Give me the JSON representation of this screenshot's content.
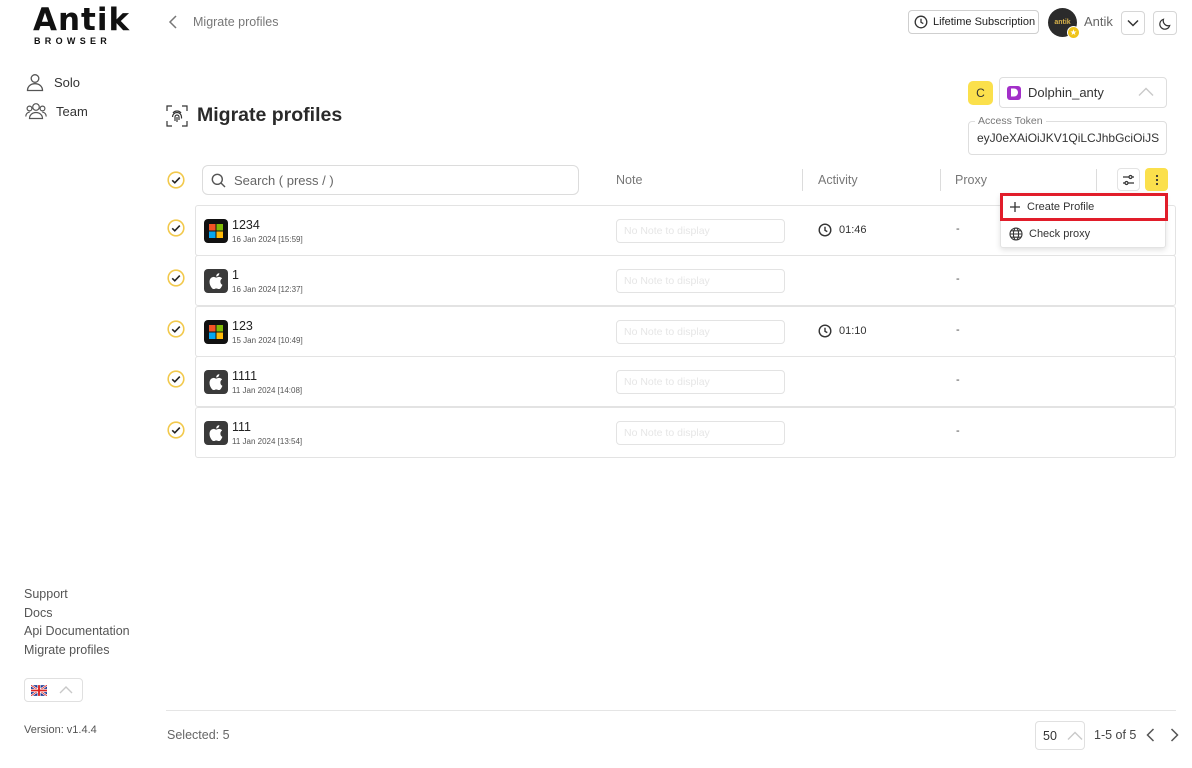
{
  "brand": {
    "logo_text": "Antik",
    "logo_sub": "BROWSER"
  },
  "sidebar": {
    "nav": [
      {
        "label": "Solo",
        "icon": "user-icon"
      },
      {
        "label": "Team",
        "icon": "team-icon"
      }
    ],
    "footer_links": [
      "Support",
      "Docs",
      "Api Documentation",
      "Migrate profiles"
    ],
    "language": "en-GB",
    "version": "Version: v1.4.4"
  },
  "topbar": {
    "breadcrumb": "Migrate profiles",
    "subscription_label": "Lifetime Subscription",
    "avatar_text": "antik",
    "username": "Antik"
  },
  "page": {
    "title": "Migrate profiles",
    "source_badge": "C",
    "source_select": "Dolphin_anty",
    "token_label": "Access Token",
    "token_value": "eyJ0eXAiOiJKV1QiLCJhbGciOiJS"
  },
  "table": {
    "search_placeholder": "Search ( press / )",
    "columns": {
      "note": "Note",
      "activity": "Activity",
      "proxy": "Proxy"
    },
    "note_placeholder": "No Note to display",
    "rows": [
      {
        "name": "1234",
        "date": "16 Jan 2024 [15:59]",
        "os": "windows",
        "activity": "01:46",
        "proxy": "-"
      },
      {
        "name": "1",
        "date": "16 Jan 2024 [12:37]",
        "os": "macos",
        "activity": "",
        "proxy": "-"
      },
      {
        "name": "123",
        "date": "15 Jan 2024 [10:49]",
        "os": "windows",
        "activity": "01:10",
        "proxy": "-"
      },
      {
        "name": "1111",
        "date": "11 Jan 2024 [14:08]",
        "os": "macos",
        "activity": "",
        "proxy": "-"
      },
      {
        "name": "111",
        "date": "11 Jan 2024 [13:54]",
        "os": "macos",
        "activity": "",
        "proxy": "-"
      }
    ]
  },
  "menu": {
    "items": [
      {
        "label": "Create Profile",
        "icon": "plus-icon"
      },
      {
        "label": "Check proxy",
        "icon": "globe-icon"
      }
    ]
  },
  "footer": {
    "selected": "Selected: 5",
    "per_page": "50",
    "range": "1-5 of 5"
  },
  "colors": {
    "accent_yellow": "#fbe04c",
    "check_yellow": "#f2c94c",
    "highlight_red": "#e11d2a",
    "dolphin_purple": "#a330c9"
  }
}
